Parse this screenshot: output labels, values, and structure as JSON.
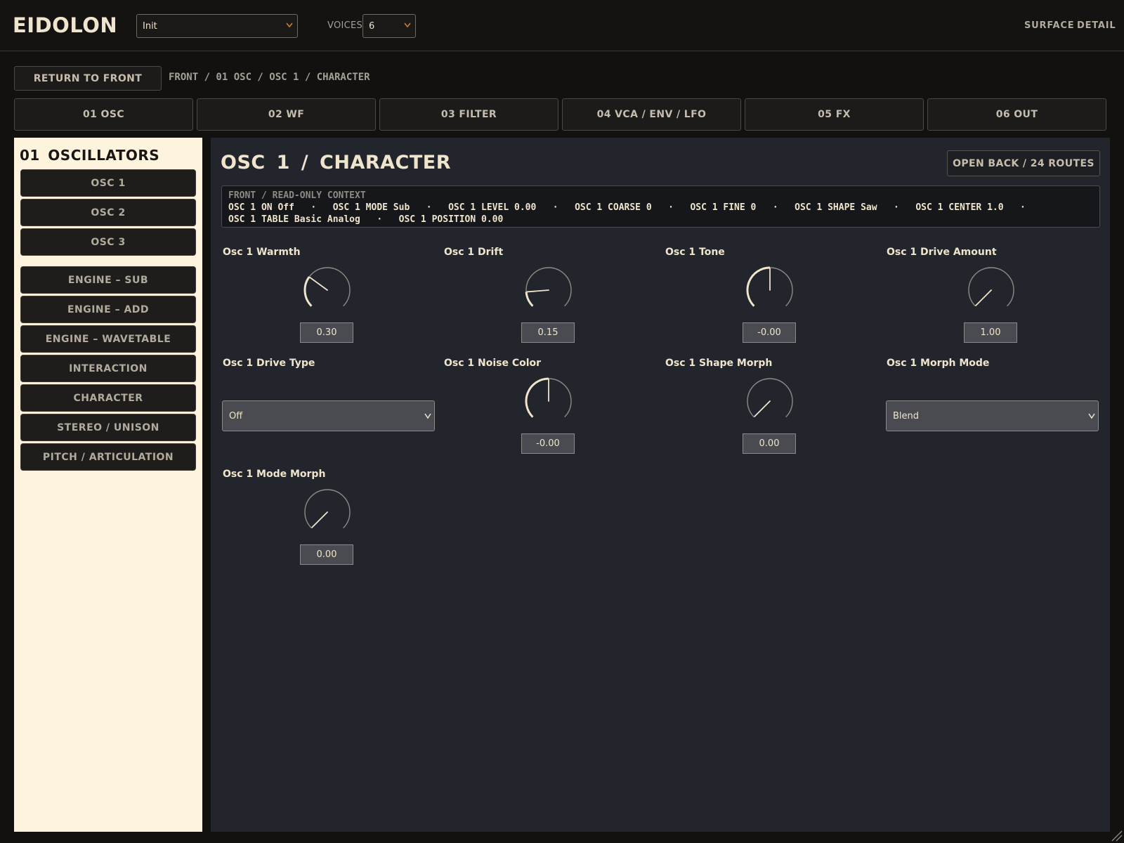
{
  "app": {
    "title": "EIDOLON",
    "preset": "Init",
    "voices_label": "VOICES",
    "voices": "6",
    "views": [
      "SURFACE",
      "DETAIL"
    ]
  },
  "nav": {
    "return_label": "RETURN TO FRONT",
    "breadcrumb": "FRONT / 01 OSC / OSC 1 / CHARACTER"
  },
  "tabs": [
    "01 OSC",
    "02 WF",
    "03 FILTER",
    "04 VCA / ENV / LFO",
    "05 FX",
    "06 OUT"
  ],
  "sidebar": {
    "title": "01  OSCILLATORS",
    "items": [
      "OSC 1",
      "OSC 2",
      "OSC 3",
      "ENGINE – SUB",
      "ENGINE – ADD",
      "ENGINE – WAVETABLE",
      "INTERACTION",
      "CHARACTER",
      "STEREO / UNISON",
      "PITCH / ARTICULATION"
    ]
  },
  "panel": {
    "title": "OSC 1  /  CHARACTER",
    "open_back_label": "OPEN BACK / 24 ROUTES",
    "context_heading": "FRONT / READ-ONLY CONTEXT",
    "context_line1": "OSC 1 ON Off   ·   OSC 1 MODE Sub   ·   OSC 1 LEVEL 0.00   ·   OSC 1 COARSE 0   ·   OSC 1 FINE 0   ·   OSC 1 SHAPE Saw   ·   OSC 1 CENTER 1.0   ·",
    "context_line2": "OSC 1 TABLE Basic Analog   ·   OSC 1 POSITION 0.00",
    "params": [
      {
        "label": "Osc 1 Warmth",
        "type": "knob",
        "value": "0.30",
        "norm": 0.3
      },
      {
        "label": "Osc 1 Drift",
        "type": "knob",
        "value": "0.15",
        "norm": 0.15
      },
      {
        "label": "Osc 1 Tone",
        "type": "knob",
        "value": "-0.00",
        "norm": 0.5
      },
      {
        "label": "Osc 1 Drive Amount",
        "type": "knob",
        "value": "1.00",
        "norm": 0.0
      },
      {
        "label": "Osc 1 Drive Type",
        "type": "select",
        "value": "Off"
      },
      {
        "label": "Osc 1 Noise Color",
        "type": "knob",
        "value": "-0.00",
        "norm": 0.5
      },
      {
        "label": "Osc 1 Shape Morph",
        "type": "knob",
        "value": "0.00",
        "norm": 0.0
      },
      {
        "label": "Osc 1 Morph Mode",
        "type": "select",
        "value": "Blend"
      },
      {
        "label": "Osc 1 Mode Morph",
        "type": "knob",
        "value": "0.00",
        "norm": 0.0
      }
    ]
  },
  "colors": {
    "accent": "#c9832f",
    "knob_arc": "#efe4cc",
    "knob_track": "#8d8b86",
    "sidebar_bg": "#fef3dd",
    "panel_bg": "#23252c"
  }
}
